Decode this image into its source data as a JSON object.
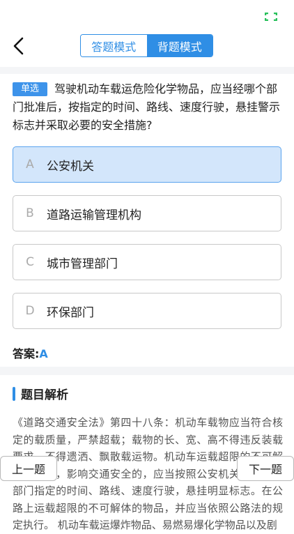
{
  "status_icon": "expand-icon",
  "header": {
    "back_icon": "chevron-left-icon",
    "modes": [
      "答题模式",
      "背题模式"
    ],
    "active_mode": "背题模式"
  },
  "question": {
    "type": "单选",
    "text": "驾驶机动车载运危险化学物品，应当经哪个部门批准后，按指定的时间、路线、速度行驶，悬挂警示标志并采取必要的安全措施?"
  },
  "options": [
    {
      "letter": "A",
      "text": "公安机关",
      "selected": true
    },
    {
      "letter": "B",
      "text": "道路运输管理机构",
      "selected": false
    },
    {
      "letter": "C",
      "text": "城市管理部门",
      "selected": false
    },
    {
      "letter": "D",
      "text": "环保部门",
      "selected": false
    }
  ],
  "answer": {
    "label": "答案:",
    "value": "A"
  },
  "analysis": {
    "title": "题目解析",
    "text": "《道路交通安全法》第四十八条：机动车载物应当符合核定的载质量，严禁超载；载物的长、宽、高不得违反装载要求，不得遗洒、飘散载运物。机动车运载超限的不可解体的物品，影响交通安全的，应当按照公安机关交通管理部门指定的时间、路线、速度行驶，悬挂明显标志。在公路上运载超限的不可解体的物品，并应当依照公路法的规定执行。 机动车载运爆炸物品、易燃易爆化学物品以及剧"
  },
  "nav": {
    "prev": "上一题",
    "next": "下一题"
  },
  "colors": {
    "accent": "#2f8ee5",
    "selected_bg": "#d3e6fb",
    "status_green": "#27c05a"
  }
}
